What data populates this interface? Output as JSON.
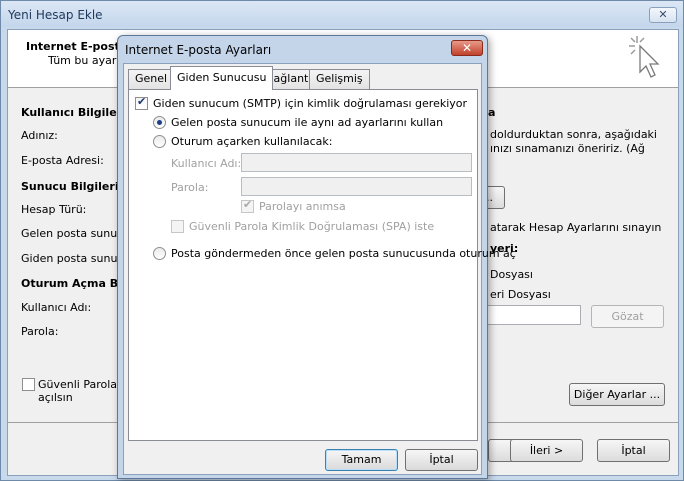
{
  "outer": {
    "title": "Yeni Hesap Ekle",
    "close_glyph": "✕",
    "header_title": "Internet E-posta",
    "header_sub": "Tüm bu ayarlar",
    "section_user": "Kullanıcı Bilgileri",
    "label_name": "Adınız:",
    "label_email": "E-posta Adresi:",
    "section_server": "Sunucu Bilgileri",
    "label_account_type": "Hesap Türü:",
    "label_incoming": "Gelen posta sunucus",
    "label_outgoing": "Giden posta sunucus",
    "section_logon": "Oturum Açma Bilg",
    "label_username": "Kullanıcı Adı:",
    "label_password": "Parola:",
    "spa_line1": "Güvenli Parola Kir",
    "spa_line2": "açılsın",
    "right_heading": "a",
    "right_text1": "doldurduktan sonra, aşağıdaki",
    "right_text2": "ınızı sınamanızı öneririz. (Ağ",
    "right_button_partial": "..",
    "right_test_text": "atarak Hesap Ayarlarını sınayın",
    "right_deliver_heading": "yeri:",
    "right_deliver_file1": "Dosyası",
    "right_deliver_file2": "eri Dosyası",
    "browse_button": "Gözat",
    "more_settings_button": "Diğer Ayarlar ...",
    "next_button": "İleri >",
    "cancel_button": "İptal"
  },
  "dialog": {
    "title": "Internet E-posta Ayarları",
    "close_glyph": "✕",
    "tabs": [
      {
        "label": "Genel"
      },
      {
        "label": "Giden Sunucusu"
      },
      {
        "label": "Bağlantı"
      },
      {
        "label": "Gelişmiş"
      }
    ],
    "smtp_auth_label": "Giden sunucum (SMTP) için kimlik doğrulaması gerekiyor",
    "radio_same_label": "Gelen posta sunucum ile aynı ad ayarlarını kullan",
    "radio_logon_label": "Oturum açarken kullanılacak:",
    "username_label": "Kullanıcı Adı:",
    "password_label": "Parola:",
    "remember_label": "Parolayı anımsa",
    "spa_label": "Güvenli Parola Kimlik Doğrulaması (SPA) iste",
    "radio_before_label": "Posta göndermeden önce gelen posta sunucusunda oturum aç",
    "ok_button": "Tamam",
    "cancel_button": "İptal"
  }
}
